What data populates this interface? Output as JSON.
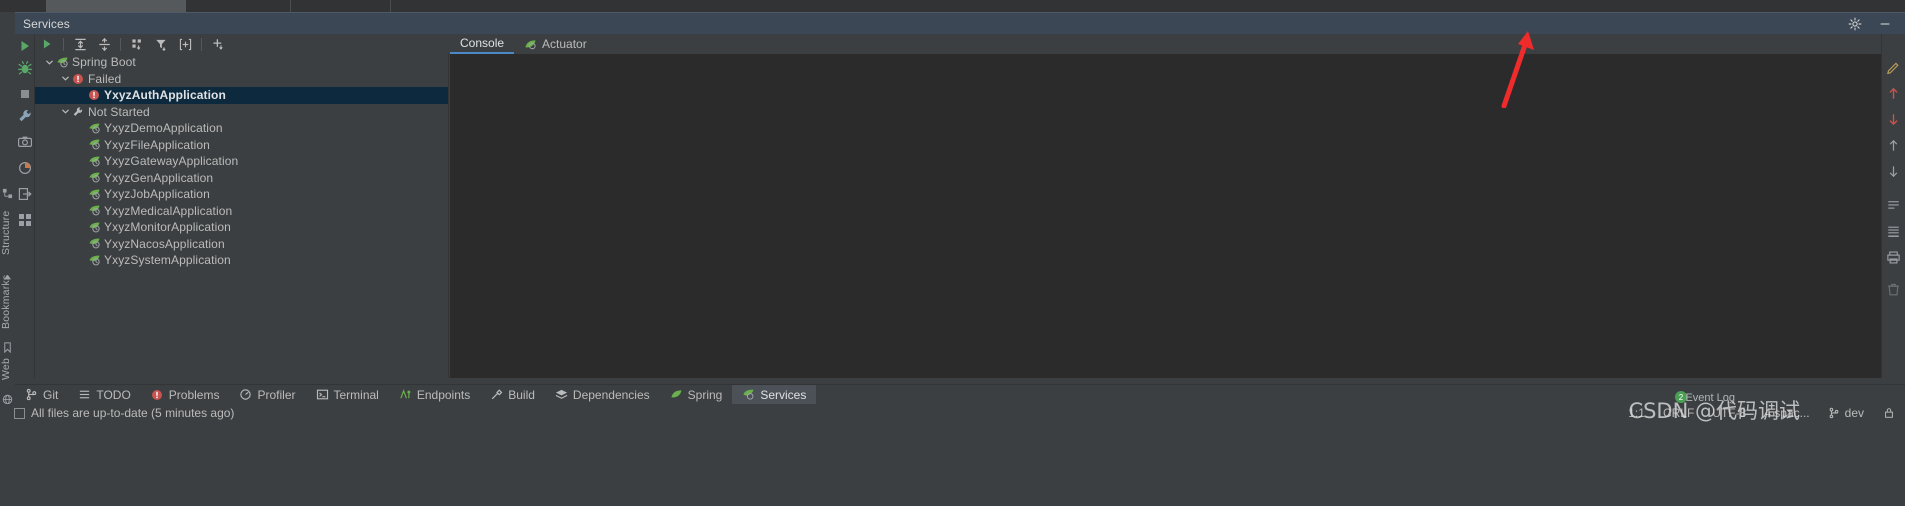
{
  "window": {
    "title": "Services",
    "settings_icon": "gear-icon",
    "minimize_icon": "minimize-icon"
  },
  "services_toolbar": {
    "items": [
      {
        "name": "run-button",
        "icon": "play-icon"
      },
      {
        "name": "expand-all-button",
        "icon": "expand-all-icon"
      },
      {
        "name": "collapse-all-button",
        "icon": "collapse-all-icon"
      },
      {
        "name": "group-by-button",
        "icon": "group-by-icon"
      },
      {
        "name": "filter-button",
        "icon": "filter-icon"
      },
      {
        "name": "show-config-button",
        "icon": "frame-plus-icon"
      },
      {
        "name": "add-service-button",
        "icon": "plus-icon"
      }
    ]
  },
  "tool_column": {
    "items": [
      {
        "name": "run-tool-icon",
        "icon": "play-icon"
      },
      {
        "name": "debug-tool-icon",
        "icon": "bug-icon"
      },
      {
        "name": "stop-tool-icon",
        "icon": "stop-icon"
      },
      {
        "name": "settings-tool-icon",
        "icon": "wrench-icon"
      },
      {
        "name": "camera-tool-icon",
        "icon": "camera-icon"
      },
      {
        "name": "coverage-tool-icon",
        "icon": "coverage-icon"
      },
      {
        "name": "export-tool-icon",
        "icon": "export-icon"
      },
      {
        "name": "layout-tool-icon",
        "icon": "layout-icon"
      }
    ]
  },
  "left_strip": {
    "items": [
      {
        "name": "structure-label",
        "label": "Structure"
      },
      {
        "name": "bookmarks-label",
        "label": "Bookmarks"
      },
      {
        "name": "web-label",
        "label": "Web"
      }
    ]
  },
  "tree": {
    "root": {
      "label": "Spring Boot",
      "icon": "spring-leaf-icon",
      "expanded": true
    },
    "groups": [
      {
        "label": "Failed",
        "icon": "error-icon",
        "expanded": true,
        "items": [
          {
            "label": "YxyzAuthApplication",
            "icon": "error-icon",
            "selected": true
          }
        ]
      },
      {
        "label": "Not Started",
        "icon": "wrench-icon",
        "expanded": true,
        "items": [
          {
            "label": "YxyzDemoApplication",
            "icon": "spring-leaf-icon",
            "selected": false
          },
          {
            "label": "YxyzFileApplication",
            "icon": "spring-leaf-icon",
            "selected": false
          },
          {
            "label": "YxyzGatewayApplication",
            "icon": "spring-leaf-icon",
            "selected": false
          },
          {
            "label": "YxyzGenApplication",
            "icon": "spring-leaf-icon",
            "selected": false
          },
          {
            "label": "YxyzJobApplication",
            "icon": "spring-leaf-icon",
            "selected": false
          },
          {
            "label": "YxyzMedicalApplication",
            "icon": "spring-leaf-icon",
            "selected": false
          },
          {
            "label": "YxyzMonitorApplication",
            "icon": "spring-leaf-icon",
            "selected": false
          },
          {
            "label": "YxyzNacosApplication",
            "icon": "spring-leaf-icon",
            "selected": false
          },
          {
            "label": "YxyzSystemApplication",
            "icon": "spring-leaf-icon",
            "selected": false
          }
        ]
      }
    ]
  },
  "content_tabs": [
    {
      "label": "Console",
      "icon": "",
      "active": true
    },
    {
      "label": "Actuator",
      "icon": "actuator-icon",
      "active": false
    }
  ],
  "right_rail": {
    "items": [
      {
        "name": "edit-rail-icon",
        "icon": "pencil-icon"
      },
      {
        "name": "up-rail-icon",
        "icon": "arrow-up-icon"
      },
      {
        "name": "down-rail-icon",
        "icon": "arrow-down-icon"
      },
      {
        "name": "soft-wrap-rail-icon",
        "icon": "arrow-up-thin-icon"
      },
      {
        "name": "scroll-end-rail-icon",
        "icon": "arrow-down-thin-icon"
      },
      {
        "name": "wrap-text-rail-icon",
        "icon": "wrap-text-icon"
      },
      {
        "name": "scroll-to-end-rail-icon",
        "icon": "scroll-end-icon"
      },
      {
        "name": "print-rail-icon",
        "icon": "printer-icon"
      },
      {
        "name": "clear-all-rail-icon",
        "icon": "trash-icon"
      }
    ]
  },
  "bottom_bar": [
    {
      "label": "Git",
      "icon": "git-branch-icon",
      "active": false
    },
    {
      "label": "TODO",
      "icon": "list-icon",
      "active": false
    },
    {
      "label": "Problems",
      "icon": "error-icon",
      "active": false
    },
    {
      "label": "Profiler",
      "icon": "profiler-icon",
      "active": false
    },
    {
      "label": "Terminal",
      "icon": "terminal-icon",
      "active": false
    },
    {
      "label": "Endpoints",
      "icon": "endpoints-icon",
      "active": false
    },
    {
      "label": "Build",
      "icon": "hammer-icon",
      "active": false
    },
    {
      "label": "Dependencies",
      "icon": "layers-icon",
      "active": false
    },
    {
      "label": "Spring",
      "icon": "spring-leaf-icon",
      "active": false
    },
    {
      "label": "Services",
      "icon": "services-icon",
      "active": true
    }
  ],
  "status_bar": {
    "message": "All files are up-to-date (5 minutes ago)",
    "caret": "1:1",
    "line_separator": "CRLF",
    "encoding": "UTF-8",
    "indent": "4 spac...",
    "branch": "dev",
    "branch_icon": "git-branch-icon",
    "lock_icon": "lock-icon",
    "event_log": "Event Log",
    "event_count": "2"
  },
  "watermark": "CSDN @代码调试"
}
